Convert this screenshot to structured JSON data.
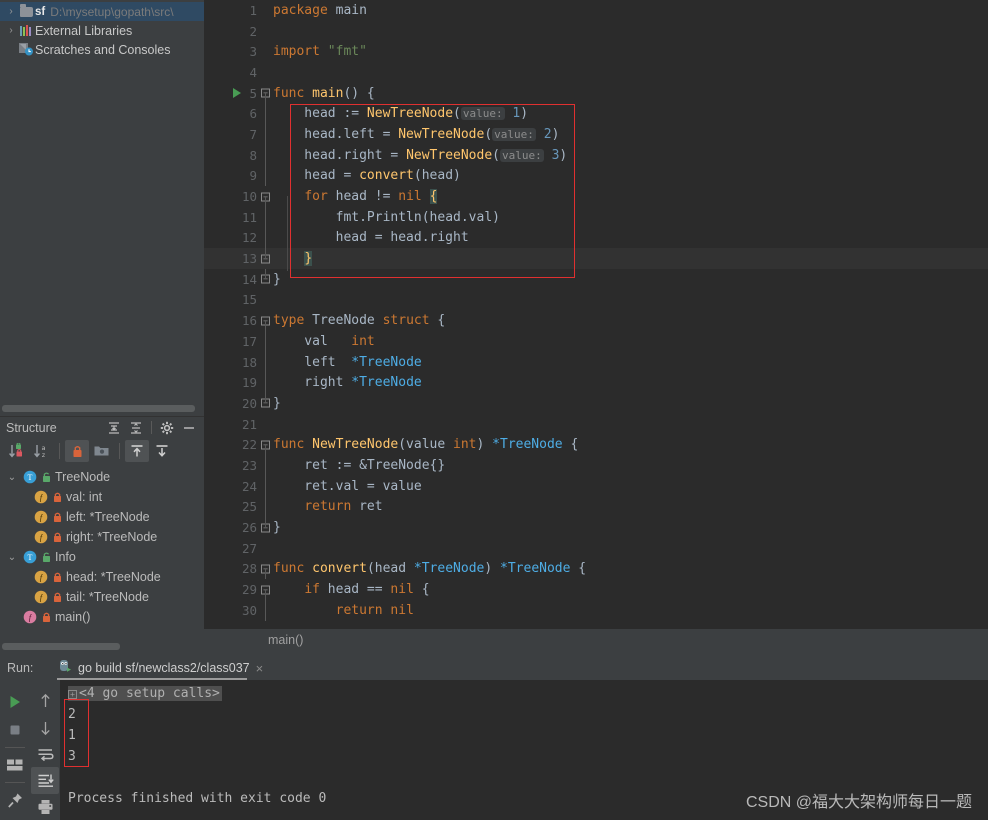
{
  "project_tree": {
    "items": [
      {
        "arrow": "›",
        "icon": "folder-icon",
        "module": "sf",
        "path": "D:\\mysetup\\gopath\\src\\",
        "selected": true
      },
      {
        "arrow": "›",
        "icon": "library-icon",
        "label": "External Libraries",
        "selected": false
      },
      {
        "arrow": "",
        "icon": "scratches-icon",
        "label": "Scratches and Consoles",
        "selected": false
      }
    ]
  },
  "structure": {
    "title": "Structure",
    "header_icons": [
      "expand-all-icon",
      "collapse-all-icon",
      "gear-icon",
      "hide-icon"
    ],
    "toolbar_icons": [
      "sort-by-visibility-icon",
      "sort-alphabetically-icon",
      "show-non-public-icon",
      "group-by-file-icon",
      "scroll-from-source-icon",
      "scroll-to-source-icon"
    ],
    "items": [
      {
        "depth": 0,
        "expanded": true,
        "kind": "T",
        "label": "TreeNode",
        "access": "public"
      },
      {
        "depth": 1,
        "expanded": false,
        "kind": "f",
        "label": "val: int",
        "access": "private"
      },
      {
        "depth": 1,
        "expanded": false,
        "kind": "f",
        "label": "left: *TreeNode",
        "access": "private"
      },
      {
        "depth": 1,
        "expanded": false,
        "kind": "f",
        "label": "right: *TreeNode",
        "access": "private"
      },
      {
        "depth": 0,
        "expanded": true,
        "kind": "T",
        "label": "Info",
        "access": "public"
      },
      {
        "depth": 1,
        "expanded": false,
        "kind": "f",
        "label": "head: *TreeNode",
        "access": "private"
      },
      {
        "depth": 1,
        "expanded": false,
        "kind": "f",
        "label": "tail: *TreeNode",
        "access": "private"
      },
      {
        "depth": 0,
        "expanded": false,
        "kind": "m",
        "label": "main()",
        "access": "private"
      }
    ]
  },
  "editor": {
    "breadcrumb": "main()",
    "lines": [
      {
        "num": "1",
        "html": "<span class=\"kw\">package</span> main"
      },
      {
        "num": "2",
        "html": ""
      },
      {
        "num": "3",
        "html": "<span class=\"kw\">import</span> <span class=\"str\">\"fmt\"</span>"
      },
      {
        "num": "4",
        "html": ""
      },
      {
        "num": "5",
        "html": "<span class=\"kw\">func</span> <span class=\"fn\">main</span>() {"
      },
      {
        "num": "6",
        "html": "    head := <span class=\"fn\">NewTreeNode</span>(<span class=\"hint\">value:</span> <span class=\"num\">1</span>)"
      },
      {
        "num": "7",
        "html": "    head.left = <span class=\"fn\">NewTreeNode</span>(<span class=\"hint\">value:</span> <span class=\"num\">2</span>)"
      },
      {
        "num": "8",
        "html": "    head.right = <span class=\"fn\">NewTreeNode</span>(<span class=\"hint\">value:</span> <span class=\"num\">3</span>)"
      },
      {
        "num": "9",
        "html": "    head = <span class=\"fn\">convert</span>(head)"
      },
      {
        "num": "10",
        "html": "    <span class=\"kw\">for</span> head != <span class=\"kw\">nil</span> <span class=\"brace-hl\">{</span>"
      },
      {
        "num": "11",
        "html": "        fmt.<span class=\"def\">Println</span>(head.val)"
      },
      {
        "num": "12",
        "html": "        head = head.right"
      },
      {
        "num": "13",
        "html": "    <span class=\"brace-hl\">}</span>"
      },
      {
        "num": "14",
        "html": "}"
      },
      {
        "num": "15",
        "html": ""
      },
      {
        "num": "16",
        "html": "<span class=\"kw\">type</span> <span class=\"def\">TreeNode</span> <span class=\"kw\">struct</span> {"
      },
      {
        "num": "17",
        "html": "    val   <span class=\"kw\">int</span>"
      },
      {
        "num": "18",
        "html": "    left  <span class=\"tname\">*TreeNode</span>"
      },
      {
        "num": "19",
        "html": "    right <span class=\"tname\">*TreeNode</span>"
      },
      {
        "num": "20",
        "html": "}"
      },
      {
        "num": "21",
        "html": ""
      },
      {
        "num": "22",
        "html": "<span class=\"kw\">func</span> <span class=\"fn\">NewTreeNode</span>(value <span class=\"kw\">int</span>) <span class=\"tname\">*TreeNode</span> {"
      },
      {
        "num": "23",
        "html": "    ret := &amp;TreeNode{}"
      },
      {
        "num": "24",
        "html": "    ret.val = value"
      },
      {
        "num": "25",
        "html": "    <span class=\"kw\">return</span> ret"
      },
      {
        "num": "26",
        "html": "}"
      },
      {
        "num": "27",
        "html": ""
      },
      {
        "num": "28",
        "html": "<span class=\"kw\">func</span> <span class=\"fn\">convert</span>(head <span class=\"tname\">*TreeNode</span>) <span class=\"tname\">*TreeNode</span> {"
      },
      {
        "num": "29",
        "html": "    <span class=\"kw\">if</span> head == <span class=\"kw\">nil</span> {"
      },
      {
        "num": "30",
        "html": "        <span class=\"kw\">return</span> <span class=\"kw\">nil</span>"
      }
    ]
  },
  "run_panel": {
    "label": "Run:",
    "tab_title": "go build sf/newclass2/class037",
    "tab_close": "×",
    "tab_icon": "go-run-icon",
    "left_tools": [
      "rerun-icon",
      "stop-icon",
      "layout-icon",
      "pin-icon"
    ],
    "right_tools": [
      "up-arrow-icon",
      "down-arrow-icon",
      "soft-wrap-icon",
      "scroll-to-end-icon",
      "print-icon"
    ],
    "console": {
      "setup_line": "<4 go setup calls>",
      "output": [
        "2",
        "1",
        "3"
      ],
      "status": "Process finished with exit code 0"
    }
  },
  "watermark": "CSDN @福大大架构师每日一题",
  "colors": {
    "editor_bg": "#2b2b2b",
    "panel_bg": "#3c3f41",
    "selection_blue": "#2f4a63",
    "accent_red": "#e03030",
    "keyword_orange": "#cc7832",
    "string_green": "#6a8759",
    "function_yellow": "#ffc66d",
    "type_blue": "#4eade5",
    "number_blue": "#6897bb",
    "run_green": "#499c54"
  }
}
